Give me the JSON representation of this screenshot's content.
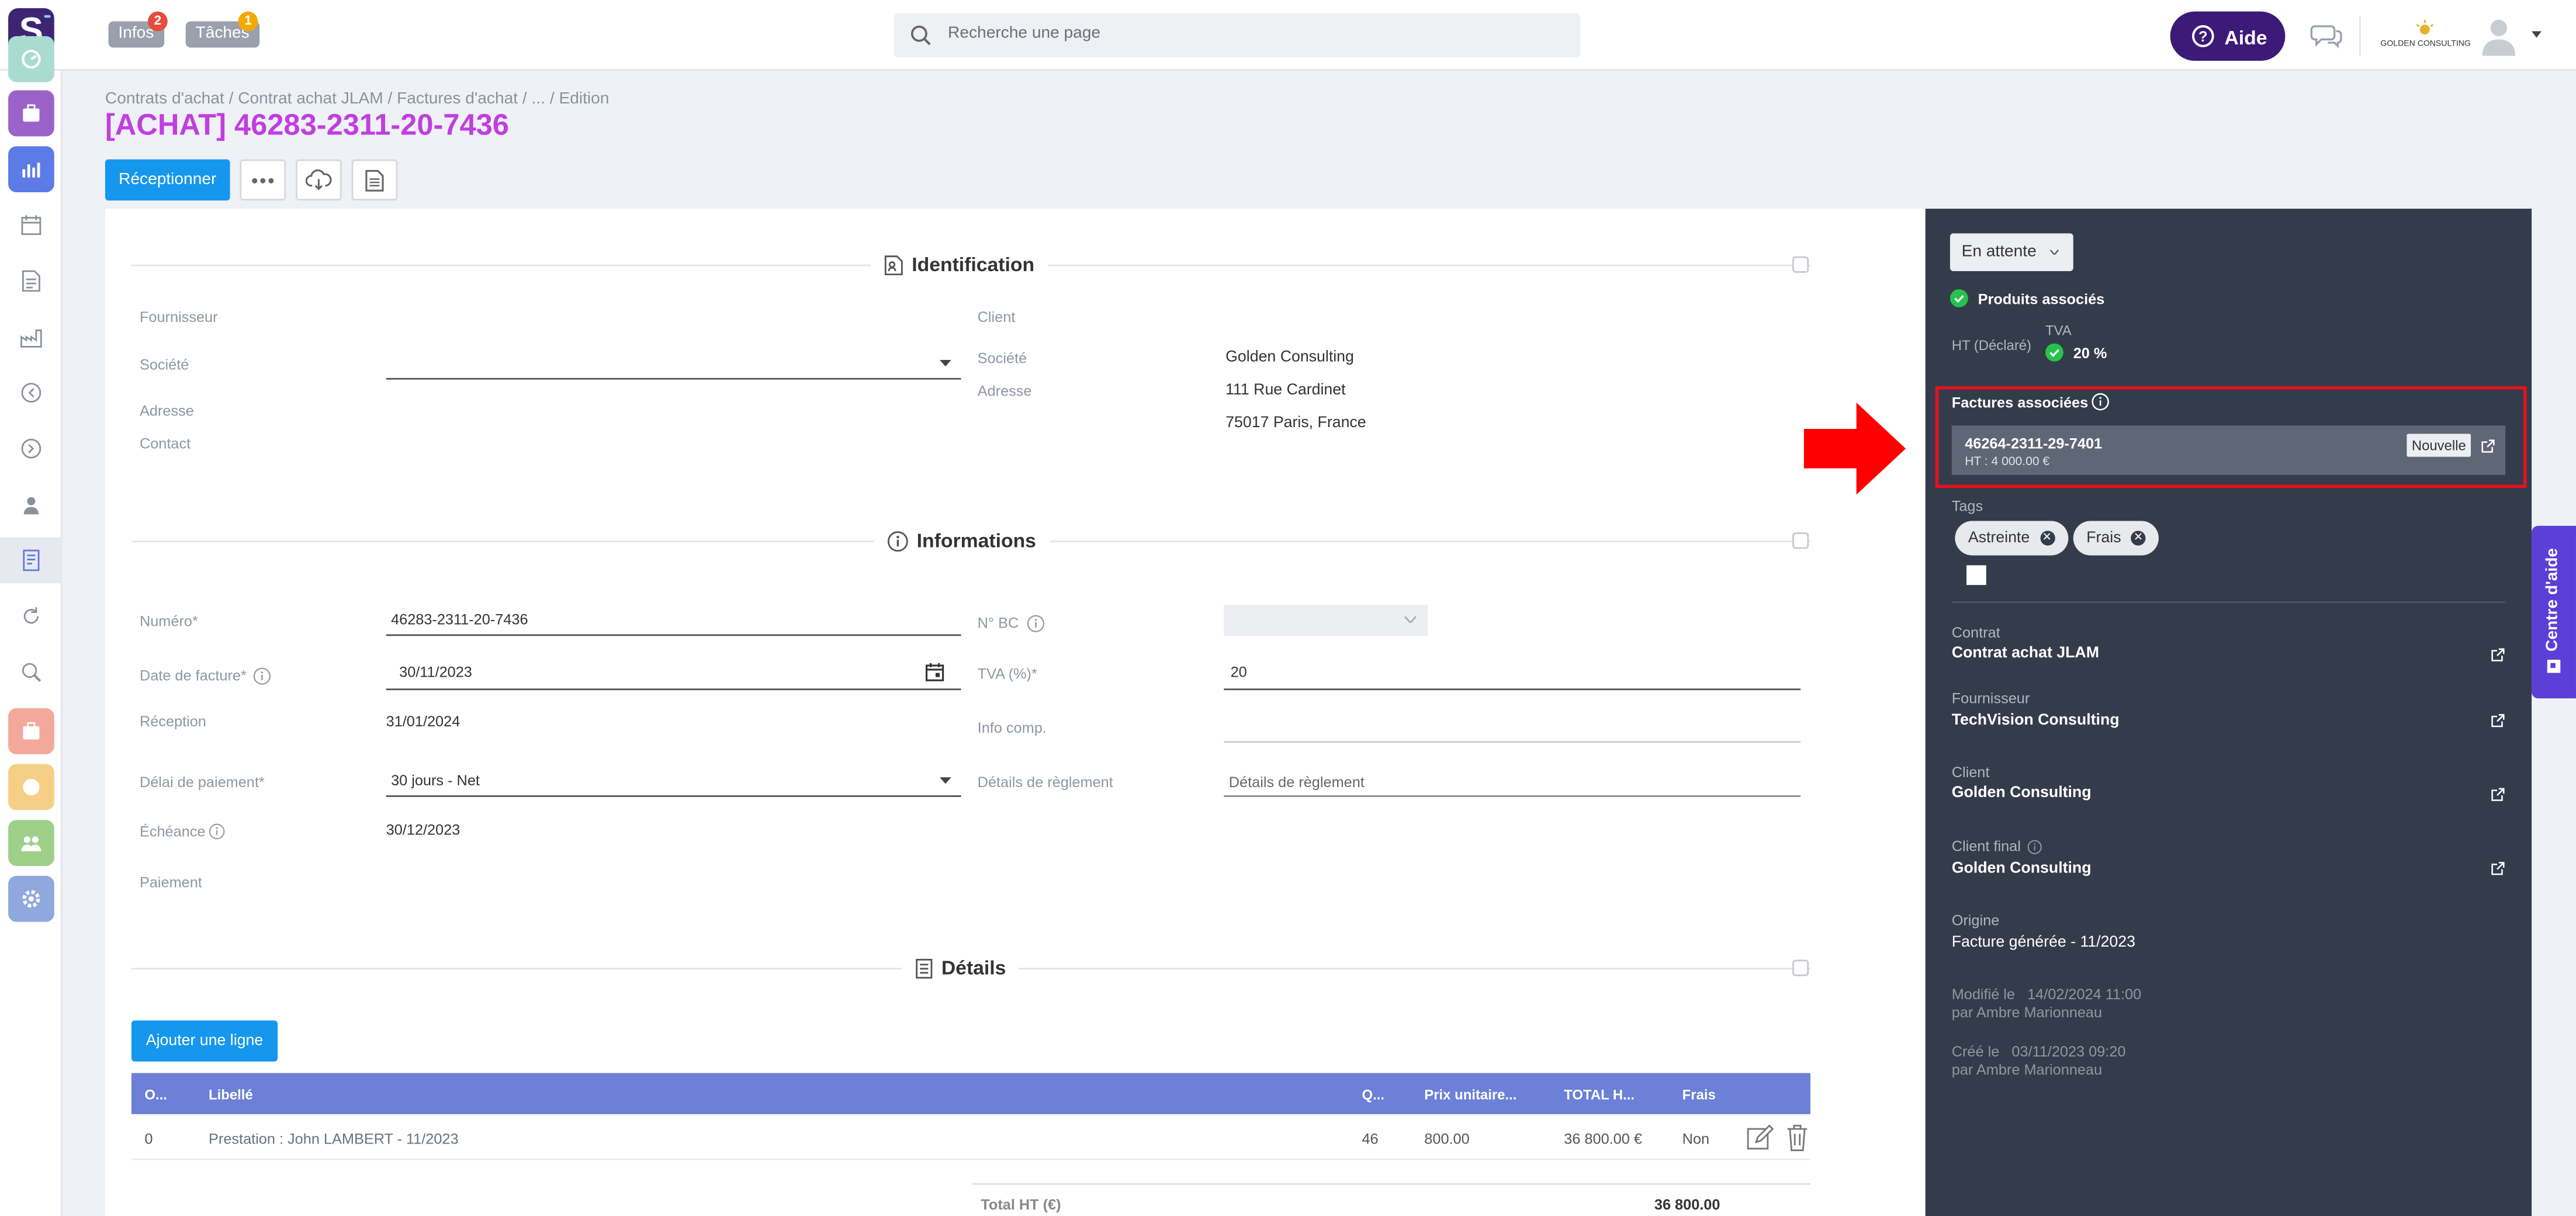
{
  "topbar": {
    "infos_label": "Infos",
    "infos_count": "2",
    "taches_label": "Tâches",
    "taches_count": "1",
    "search_placeholder": "Recherche une page",
    "aide_label": "Aide",
    "company_logo_text": "GOLDEN CONSULTING",
    "colors": {
      "brand": "#3d2574",
      "aide": "#3b1a78",
      "badge_infos": "#e74c3c",
      "badge_taches": "#f2a900"
    }
  },
  "sidebar": {
    "items": [
      {
        "icon": "dashboard-icon",
        "color": "#a9dccf"
      },
      {
        "icon": "briefcase-icon",
        "color": "#9b63c9"
      },
      {
        "icon": "bar-chart-icon",
        "color": "#5b7be6"
      },
      {
        "icon": "calendar-icon",
        "color": ""
      },
      {
        "icon": "document-icon",
        "color": ""
      },
      {
        "icon": "factory-icon",
        "color": ""
      },
      {
        "icon": "arrow-in-icon",
        "color": ""
      },
      {
        "icon": "arrow-out-icon",
        "color": ""
      },
      {
        "icon": "user-icon",
        "color": ""
      },
      {
        "icon": "invoice-icon",
        "color": "",
        "active": true
      },
      {
        "icon": "cycle-icon",
        "color": ""
      },
      {
        "icon": "search-doc-icon",
        "color": ""
      },
      {
        "icon": "briefcase-icon",
        "color": "#f4a89a"
      },
      {
        "icon": "coin-icon",
        "color": "#f6cf86"
      },
      {
        "icon": "team-icon",
        "color": "#9fd08a"
      },
      {
        "icon": "gear-icon",
        "color": "#8fa8dd"
      }
    ]
  },
  "page": {
    "breadcrumb": [
      "Contrats d'achat",
      "Contrat achat JLAM",
      "Factures d'achat",
      "...",
      "Edition"
    ],
    "title": "[ACHAT] 46283-2311-20-7436",
    "receptionner_label": "Réceptionner"
  },
  "identification": {
    "title": "Identification",
    "fournisseur_label": "Fournisseur",
    "societe_label": "Société",
    "adresse_label": "Adresse",
    "contact_label": "Contact",
    "client_label": "Client",
    "client_societe_label": "Société",
    "client_societe_value": "Golden Consulting",
    "client_adresse_label": "Adresse",
    "client_adresse_line1": "111 Rue Cardinet",
    "client_adresse_line2": "75017 Paris, France"
  },
  "informations": {
    "title": "Informations",
    "numero_label": "Numéro*",
    "numero_value": "46283-2311-20-7436",
    "nbc_label": "N° BC",
    "date_label": "Date de facture*",
    "date_value": "30/11/2023",
    "tva_label": "TVA (%)*",
    "tva_value": "20",
    "reception_label": "Réception",
    "reception_value": "31/01/2024",
    "infocomp_label": "Info comp.",
    "delai_label": "Délai de paiement*",
    "delai_value": "30 jours - Net",
    "details_reglement_label": "Détails de règlement",
    "details_reglement_placeholder": "Détails de règlement",
    "echeance_label": "Échéance",
    "echeance_value": "30/12/2023",
    "paiement_label": "Paiement"
  },
  "details": {
    "title": "Détails",
    "add_line_label": "Ajouter une ligne",
    "columns": [
      "O...",
      "Libellé",
      "Q...",
      "Prix unitaire...",
      "TOTAL H...",
      "Frais"
    ],
    "rows": [
      {
        "ordre": "0",
        "libelle": "Prestation : John LAMBERT - 11/2023",
        "qte": "46",
        "prix": "800.00",
        "total": "36 800.00 €",
        "frais": "Non"
      }
    ],
    "total_label": "Total HT (€)",
    "total_value": "36 800.00",
    "header_color": "#6b80d6"
  },
  "panel": {
    "status_label": "En attente",
    "produits_label": "Produits associés",
    "ht_label": "HT (Déclaré)",
    "tva_label": "TVA",
    "tva_value": "20 %",
    "factures_label": "Factures associées",
    "facture_num": "46264-2311-29-7401",
    "facture_ht": "HT : 4 000.00 €",
    "facture_badge": "Nouvelle",
    "tags_label": "Tags",
    "tags": [
      "Astreinte",
      "Frais"
    ],
    "contrat_label": "Contrat",
    "contrat_value": "Contrat achat JLAM",
    "fournisseur_label": "Fournisseur",
    "fournisseur_value": "TechVision Consulting",
    "client_label": "Client",
    "client_value": "Golden Consulting",
    "clientfinal_label": "Client final",
    "clientfinal_value": "Golden Consulting",
    "origine_label": "Origine",
    "origine_value": "Facture générée - 11/2023",
    "modifie_line1": "Modifié le   14/02/2024 11:00",
    "modifie_line2": "par Ambre Marionneau",
    "cree_line1": "Créé le   03/11/2023 09:20",
    "cree_line2": "par Ambre Marionneau",
    "colors": {
      "bg": "#343c4b",
      "highlight": "#e0141e",
      "ok": "#27c24c"
    }
  },
  "help_tab": {
    "label": "Centre d'aide",
    "color": "#5b3fd6"
  }
}
